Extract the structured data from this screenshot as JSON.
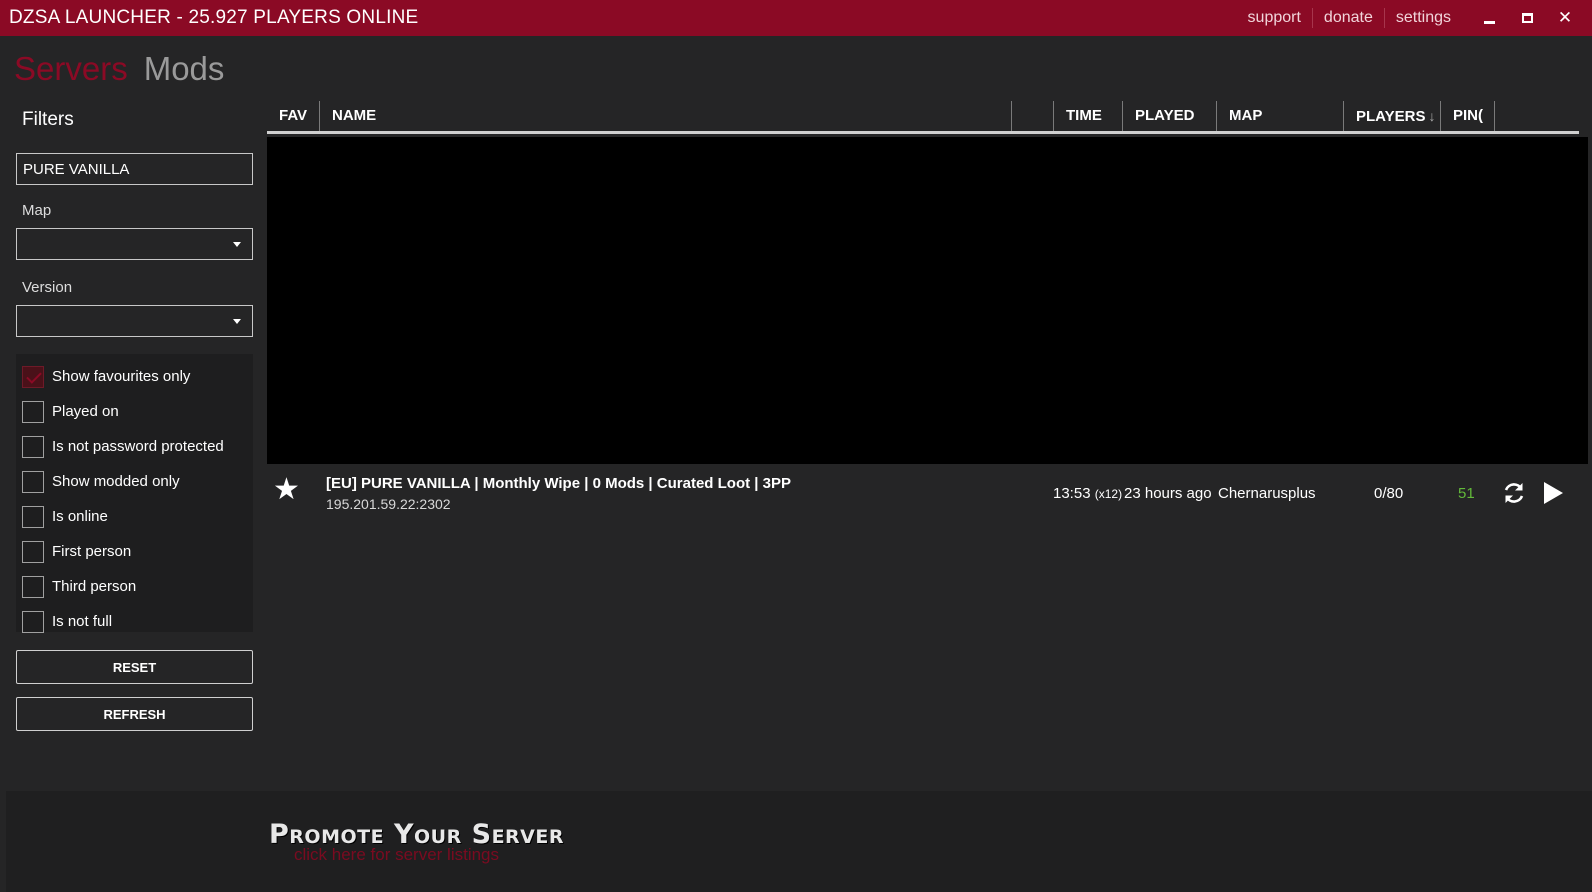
{
  "titlebar": {
    "title": "DZSA LAUNCHER - 25.927 PLAYERS ONLINE",
    "links": [
      "support",
      "donate",
      "settings"
    ],
    "close_glyph": "✕"
  },
  "nav": {
    "servers": "Servers",
    "mods": "Mods"
  },
  "sidebar": {
    "filters_title": "Filters",
    "search_value": "PURE VANILLA",
    "map_label": "Map",
    "map_value": "",
    "version_label": "Version",
    "version_value": "",
    "checkboxes": [
      {
        "label": "Show favourites only",
        "checked": true
      },
      {
        "label": "Played on",
        "checked": false
      },
      {
        "label": "Is not password protected",
        "checked": false
      },
      {
        "label": "Show modded only",
        "checked": false
      },
      {
        "label": "Is online",
        "checked": false
      },
      {
        "label": "First person",
        "checked": false
      },
      {
        "label": "Third person",
        "checked": false
      },
      {
        "label": "Is not full",
        "checked": false
      }
    ],
    "reset_label": "RESET",
    "refresh_label": "REFRESH"
  },
  "table": {
    "columns": {
      "fav": "FAV",
      "name": "NAME",
      "blank": "",
      "time": "TIME",
      "played": "PLAYED",
      "map": "MAP",
      "players": "PLAYERS",
      "ping": "PIN("
    },
    "sort_glyph": "↓",
    "rows": [
      {
        "star": "★",
        "name": "[EU] PURE VANILLA | Monthly Wipe | 0 Mods | Curated Loot | 3PP",
        "ip": "195.201.59.22:2302",
        "time": "13:53",
        "time_mult": "(x12)",
        "played": "23 hours ago",
        "map": "Chernarusplus",
        "players": "0/80",
        "ping": "51"
      }
    ]
  },
  "promo": {
    "title": "Promote Your Server",
    "subtitle": "click here for server listings"
  },
  "colors": {
    "accent": "#8b0a25",
    "background": "#252526",
    "ping_good": "#62b93a"
  }
}
